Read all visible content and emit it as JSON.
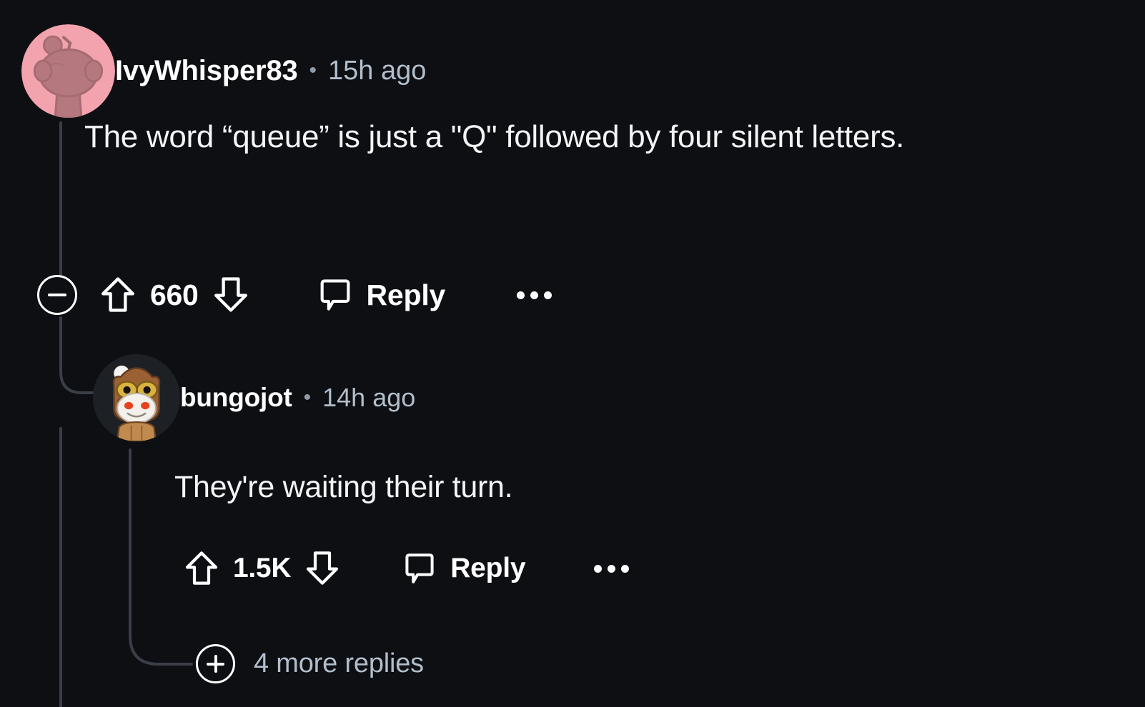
{
  "theme": {
    "background": "#0d0f13",
    "text_primary": "#f2f4f6",
    "text_muted": "#b2becb",
    "thread_line": "#3a3f47",
    "icon": "#ffffff",
    "avatar_bg_primary": "#f2a3ad"
  },
  "comments": [
    {
      "id": "comment-top-level",
      "depth": 0,
      "author": "IvyWhisper83",
      "separator": "•",
      "timestamp": "15h ago",
      "body": "The word “queue” is just a \"Q\" followed by four silent letters.",
      "avatar": {
        "name": "reddit-snoo-avatar-pink",
        "background": "#f2a3ad",
        "figure": "#a66b72"
      },
      "actions": {
        "collapse": "collapse-thread",
        "upvote": "upvote",
        "vote_count": "660",
        "downvote": "downvote",
        "reply_icon": "comment-bubble-icon",
        "reply_label": "Reply",
        "overflow": "more-options"
      }
    },
    {
      "id": "comment-reply",
      "depth": 1,
      "author": "bungojot",
      "separator": "•",
      "timestamp": "14h ago",
      "body": "They're waiting their turn.",
      "avatar": {
        "name": "reddit-snoo-avatar-owl-costume",
        "background": "#1d2024",
        "hood": "#8a5a33",
        "goggles": "#d9b23f",
        "face": "#f0ece6",
        "eyes": "#e8411f"
      },
      "actions": {
        "upvote": "upvote",
        "vote_count": "1.5K",
        "downvote": "downvote",
        "reply_icon": "comment-bubble-icon",
        "reply_label": "Reply",
        "overflow": "more-options"
      }
    }
  ],
  "more_replies": {
    "icon": "plus-circle-icon",
    "label": "4 more replies"
  }
}
